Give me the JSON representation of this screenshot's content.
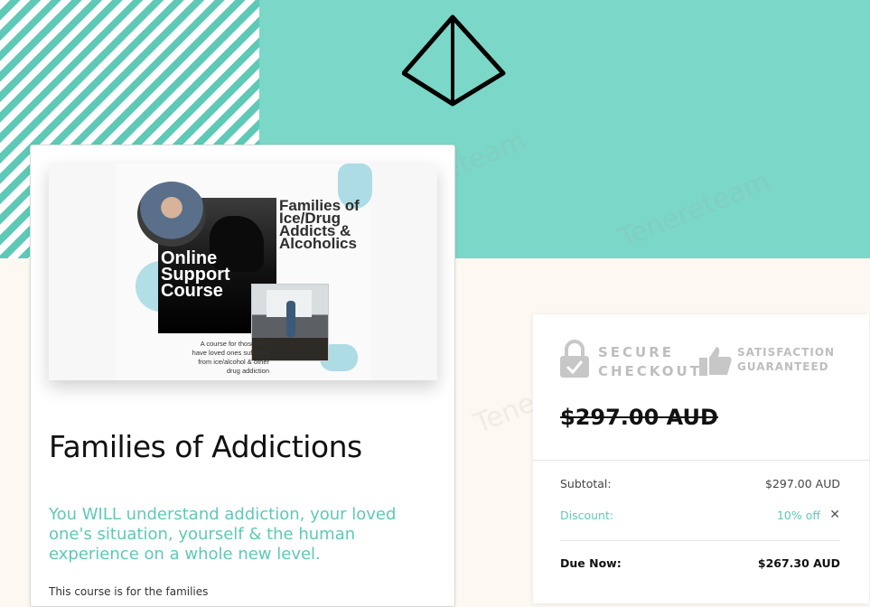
{
  "colors": {
    "header_teal": "#7bd7c7",
    "accent_teal": "#5ec9b6",
    "page_cream": "#fdf8f1",
    "text_dark": "#111111"
  },
  "header": {
    "logo_icon": "diamond-pyramid-icon"
  },
  "course": {
    "promo_image": {
      "headline": "Families of\nIce/Drug\nAddicts &\nAlcoholics",
      "badge": "Online\nSupport\nCourse",
      "caption": "A course for those who\nhave loved ones suffering\nfrom ice/alcohol & other\ndrug addiction"
    },
    "title": "Families of Addictions",
    "tagline": "You WILL understand addiction, your loved one's situation, yourself & the human experience on a whole new level.",
    "body_start": "This course is for the families"
  },
  "checkout": {
    "badges": {
      "secure": "SECURE\nCHECKOUT",
      "secure_icon": "lock-check-icon",
      "satisfaction": "SATISFACTION\nGUARANTEED",
      "satisfaction_icon": "thumbs-up-icon"
    },
    "original_price": "$297.00 AUD",
    "subtotal_label": "Subtotal:",
    "subtotal_value": "$297.00 AUD",
    "discount_label": "Discount:",
    "discount_value": "10% off",
    "remove_discount_icon": "close-icon",
    "due_label": "Due Now:",
    "due_value": "$267.30 AUD"
  },
  "watermark": "Tenereteam"
}
